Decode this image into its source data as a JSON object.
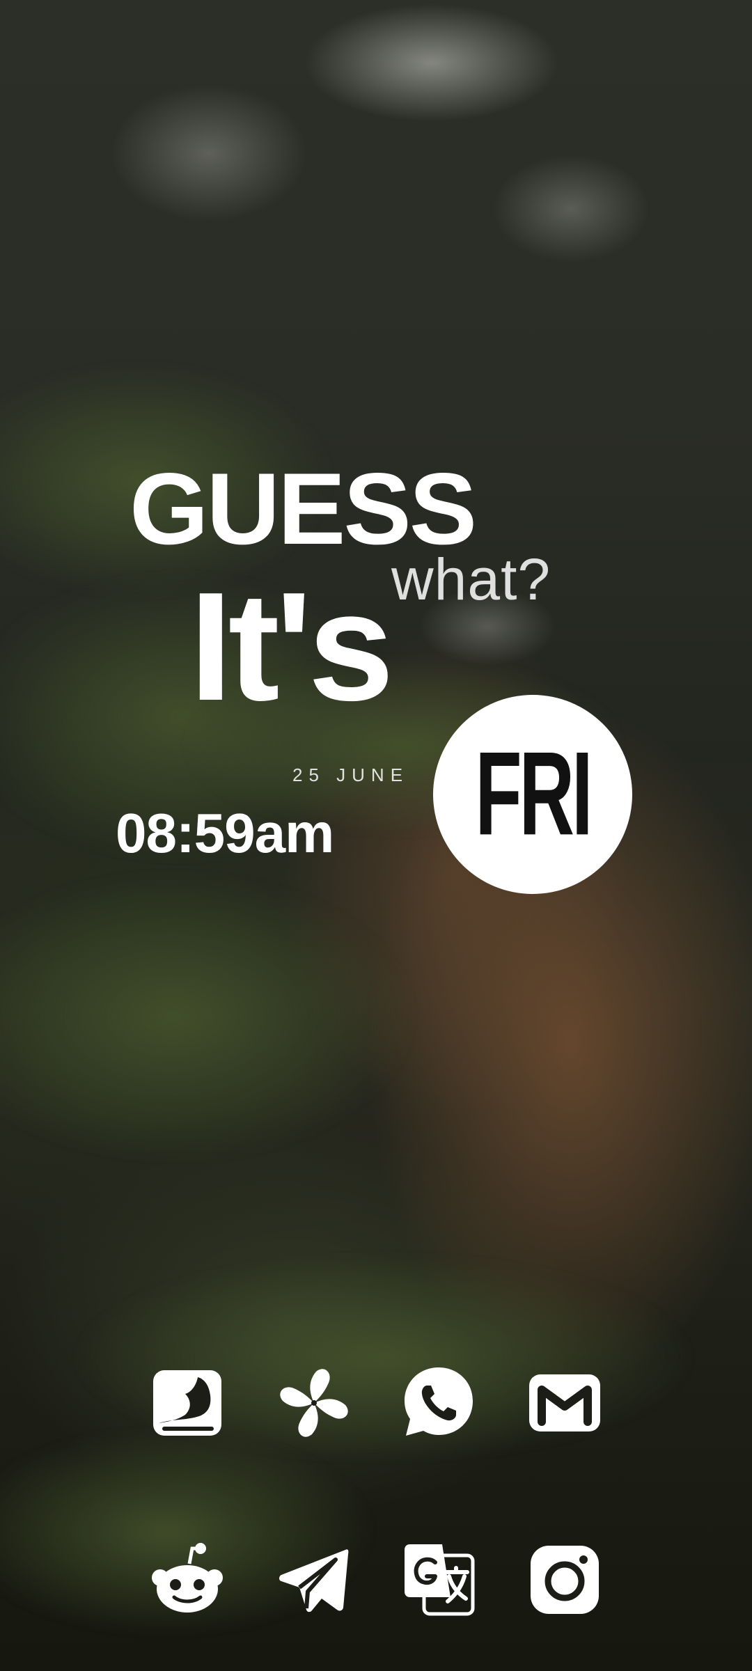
{
  "widget": {
    "headline": "GUESS",
    "subline": "what?",
    "its": "It's",
    "date": "25 JUNE",
    "time": "08:59am",
    "day": "FRI"
  },
  "dock": {
    "row1": [
      {
        "icon": "photo-app-icon"
      },
      {
        "icon": "pinwheel-app-icon"
      },
      {
        "icon": "whatsapp-icon"
      },
      {
        "icon": "gmail-icon"
      }
    ],
    "row2": [
      {
        "icon": "reddit-icon"
      },
      {
        "icon": "telegram-icon"
      },
      {
        "icon": "google-translate-icon"
      },
      {
        "icon": "instagram-icon"
      }
    ]
  },
  "colors": {
    "foreground": "#ffffff",
    "day_text": "#111111"
  }
}
